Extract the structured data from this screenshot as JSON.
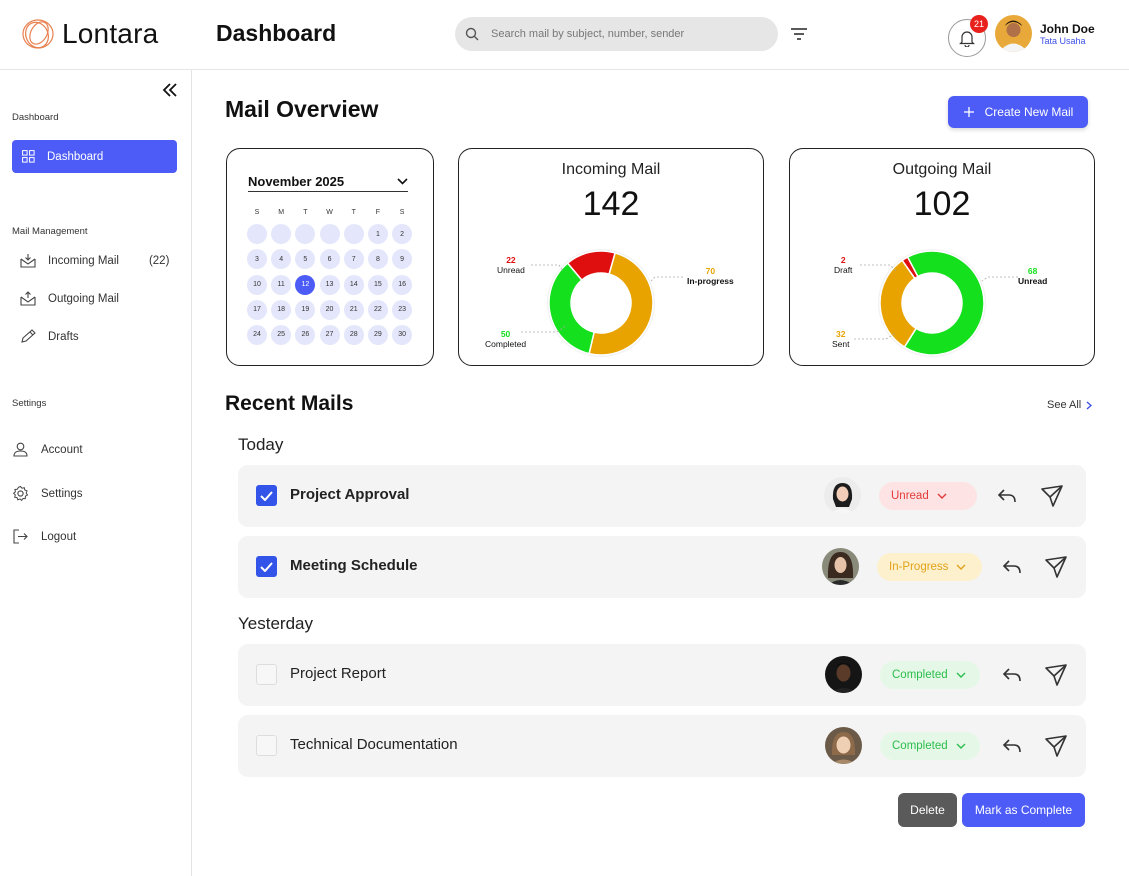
{
  "app": {
    "name": "Lontara"
  },
  "header": {
    "title": "Dashboard",
    "search_placeholder": "Search mail by subject, number, sender",
    "notification_count": "21",
    "user": {
      "name": "John Doe",
      "role": "Tata Usaha"
    }
  },
  "sidebar": {
    "section_dashboard": "Dashboard",
    "dashboard_item": "Dashboard",
    "section_mail": "Mail Management",
    "mail_items": [
      {
        "label": "Incoming Mail",
        "count": "(22)"
      },
      {
        "label": "Outgoing Mail"
      },
      {
        "label": "Drafts"
      }
    ],
    "section_settings": "Settings",
    "settings_items": [
      {
        "label": "Account"
      },
      {
        "label": "Settings"
      },
      {
        "label": "Logout"
      }
    ]
  },
  "overview": {
    "title": "Mail Overview",
    "create_button": "Create New Mail",
    "calendar": {
      "month": "November",
      "year": "2025",
      "weekdays": [
        "S",
        "M",
        "T",
        "W",
        "T",
        "F",
        "S"
      ],
      "leading_blanks": 5,
      "days_in_month": 30,
      "selected_day": 12
    },
    "incoming": {
      "title": "Incoming Mail",
      "total": "142",
      "segments": [
        {
          "label": "Unread",
          "value": 22,
          "color": "#e00f0f"
        },
        {
          "label": "In-progress",
          "value": 70,
          "color": "#e8a300"
        },
        {
          "label": "Completed",
          "value": 50,
          "color": "#14e01e"
        }
      ]
    },
    "outgoing": {
      "title": "Outgoing Mail",
      "total": "102",
      "segments": [
        {
          "label": "Draft",
          "value": 2,
          "color": "#e00f0f"
        },
        {
          "label": "Unread",
          "value": 68,
          "color": "#14e01e"
        },
        {
          "label": "Sent",
          "value": 32,
          "color": "#e8a300"
        }
      ]
    }
  },
  "recent": {
    "title": "Recent Mails",
    "see_all": "See All",
    "groups": [
      {
        "label": "Today",
        "mails": [
          {
            "subject": "Project Approval",
            "checked": true,
            "status": "Unread"
          },
          {
            "subject": "Meeting Schedule",
            "checked": true,
            "status": "In-Progress"
          }
        ]
      },
      {
        "label": "Yesterday",
        "mails": [
          {
            "subject": "Project Report",
            "checked": false,
            "status": "Completed"
          },
          {
            "subject": "Technical Documentation",
            "checked": false,
            "status": "Completed"
          }
        ]
      }
    ]
  },
  "actions": {
    "delete": "Delete",
    "mark_complete": "Mark as Complete"
  },
  "colors": {
    "accent": "#4d5cf6",
    "red": "#e00f0f",
    "orange": "#e8a300",
    "green": "#14e01e"
  }
}
